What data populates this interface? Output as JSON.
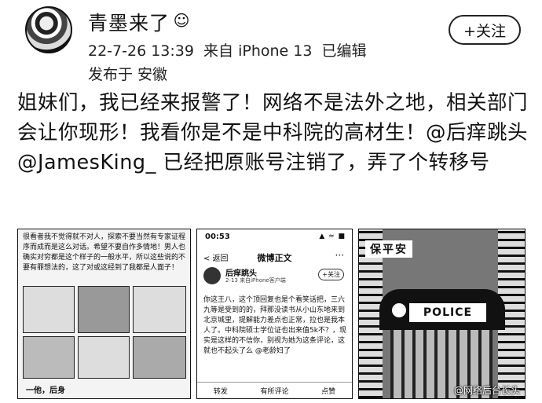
{
  "header": {
    "username": "青墨来了",
    "vip_icon": "☺",
    "timestamp": "22-7-26 13:39",
    "source": "来自 iPhone 13",
    "edited": "已编辑",
    "location": "发布于 安徽",
    "follow_label": "+关注"
  },
  "post": {
    "text": "姐妹们，我已经来报警了！网络不是法外之地，相关部门会让你现形！我看你是不是中科院的高材生！@后痒跳头 @JamesKing_ 已经把原账号注销了，弄了个转移号"
  },
  "images": {
    "img1": {
      "text": "很看者我不觉得就不对人，探索不要当然有专家证程序而成而是这么对话。希望不要自作多情地！男人也确实对穷都是这个样子的一般水平，所以这些说的不要有罪想法的，这了对或这经到了我都是人面子！",
      "caption": "一他，后身"
    },
    "img2": {
      "time": "00:53",
      "status": "▲ ≈ ■",
      "back": "< 返回",
      "title": "微博正文",
      "more": "···",
      "name": "后痒跳头",
      "sub": "2-13 来自iPhone客户端",
      "follow": "+关注",
      "body": "你这王八，这个顶回复也是个看笑话把，三六九等是受到的的，拜那没读书从小山东地来到北京城里，提解能力差点也正常，拉也是我本人了。中科院硕士学位证也出来值5k不？，现实是这样的不信你，别视为她为这条评论，这就也不起头了么 @老龄妇了",
      "bar_left": "转发",
      "bar_mid": "有所评论",
      "bar_right": "点赞"
    },
    "img3": {
      "sign": "保平安",
      "police": "POLICE",
      "watermark": "@网络后台长头"
    }
  }
}
